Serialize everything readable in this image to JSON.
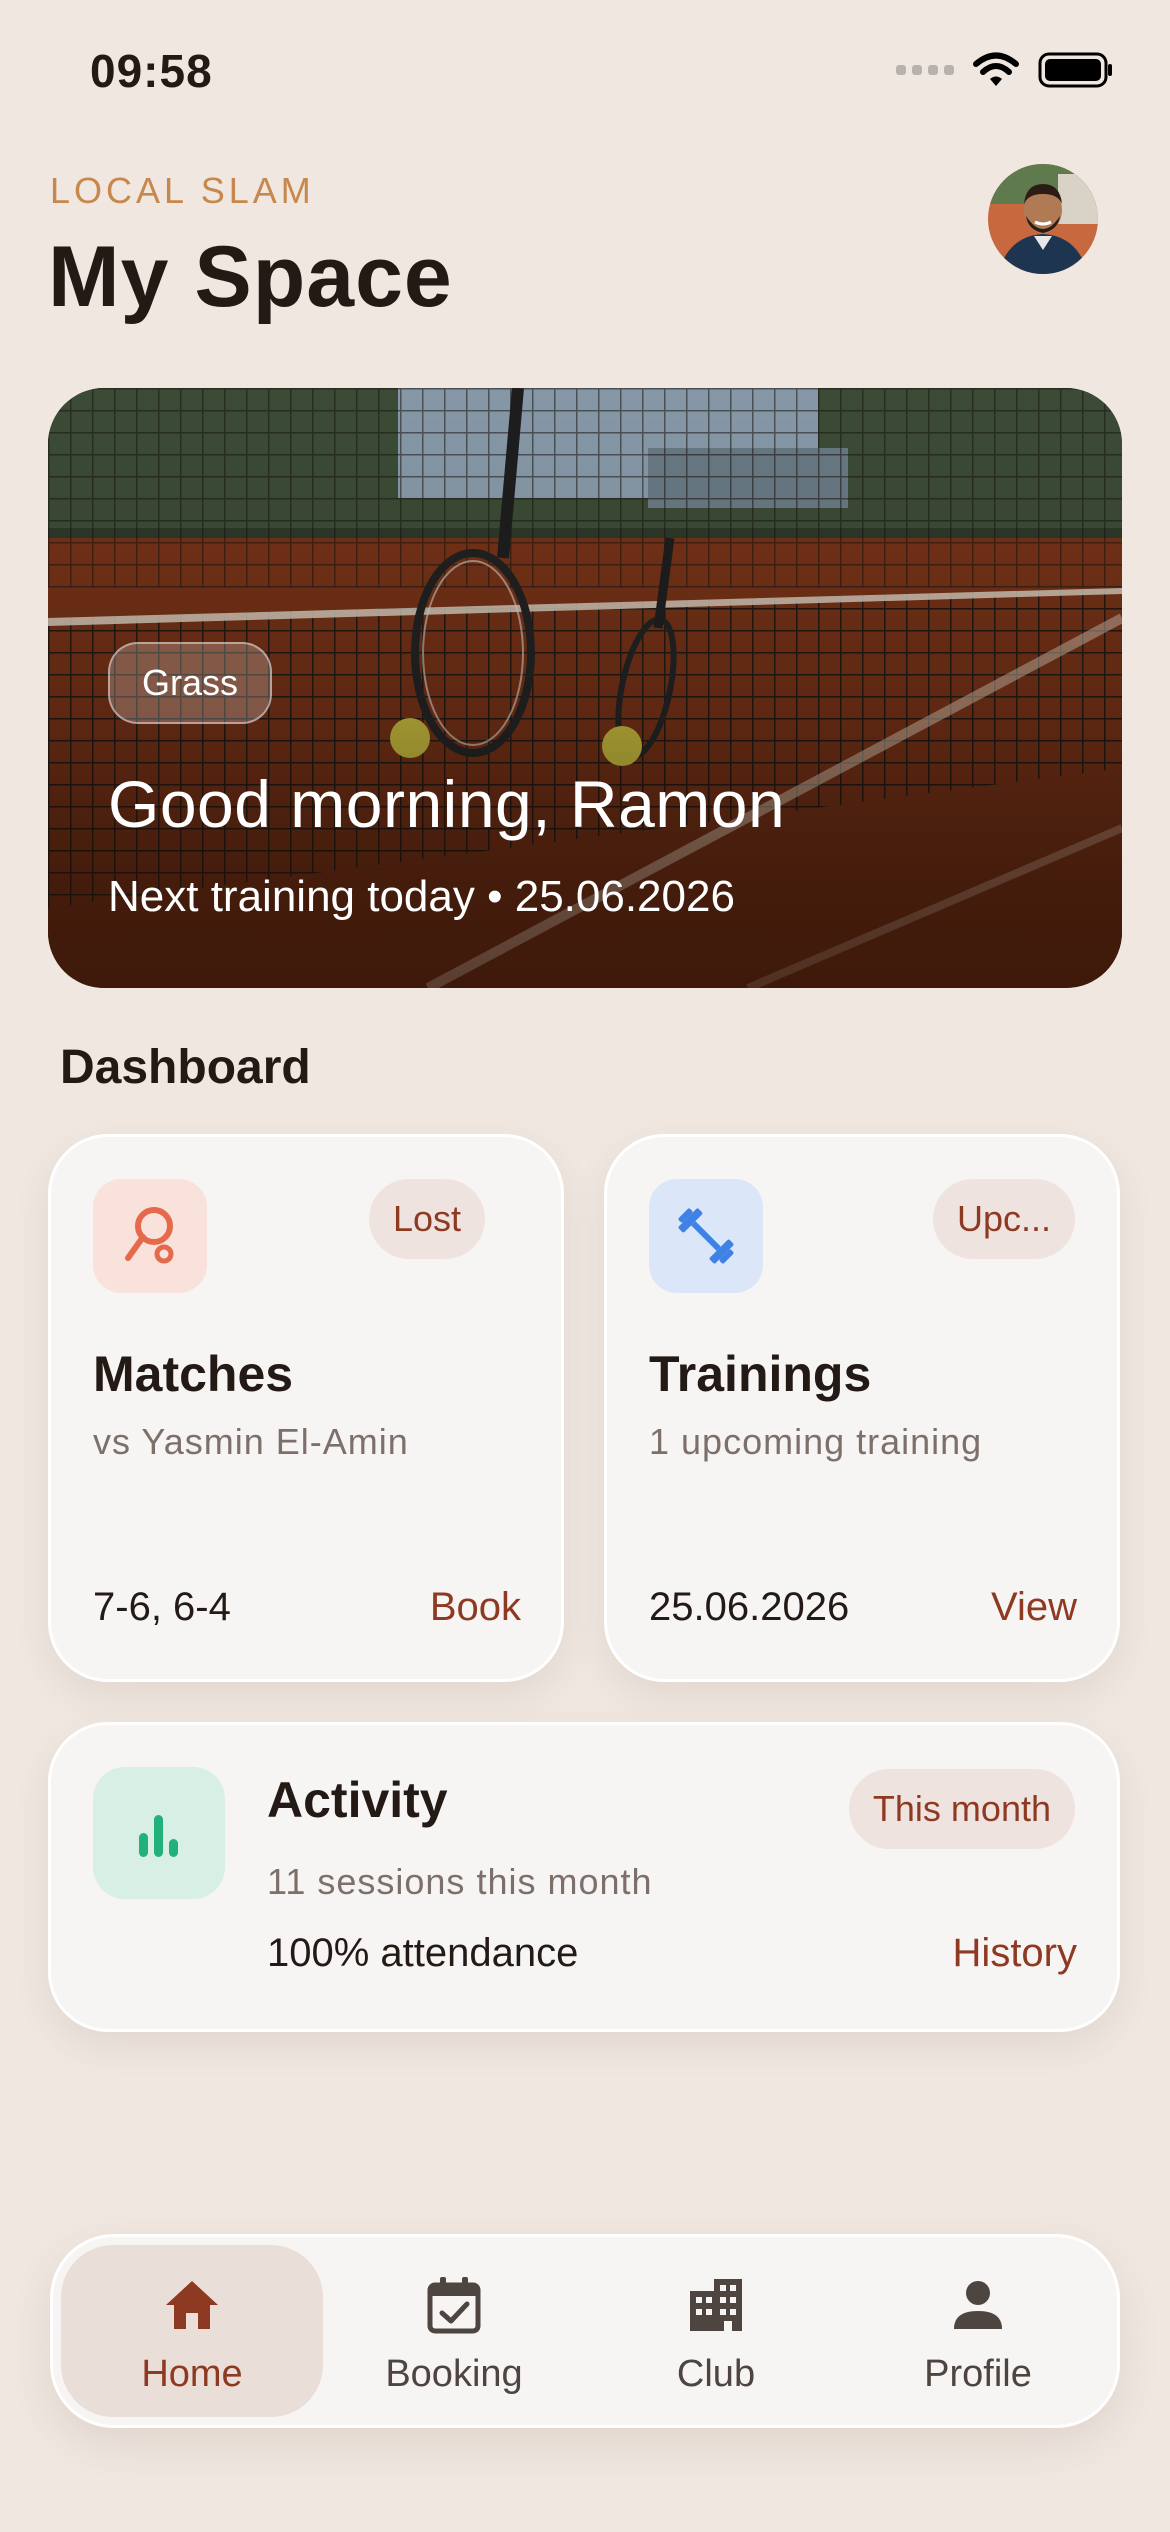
{
  "status_bar": {
    "time": "09:58"
  },
  "header": {
    "brand": "LOCAL SLAM",
    "title": "My Space"
  },
  "hero": {
    "surface_chip": "Grass",
    "greeting": "Good morning, Ramon",
    "subtitle": "Next training today • 25.06.2026"
  },
  "dashboard": {
    "section_title": "Dashboard",
    "matches": {
      "badge": "Lost",
      "title": "Matches",
      "subtitle": "vs Yasmin El-Amin",
      "score": "7-6, 6-4",
      "action": "Book",
      "icon": "tennis-racket-icon"
    },
    "trainings": {
      "badge": "Upc...",
      "title": "Trainings",
      "subtitle": "1 upcoming training",
      "date": "25.06.2026",
      "action": "View",
      "icon": "dumbbell-icon"
    },
    "activity": {
      "badge": "This month",
      "title": "Activity",
      "subtitle": "11 sessions this month",
      "attendance": "100% attendance",
      "action": "History",
      "icon": "bar-chart-icon"
    }
  },
  "bottom_nav": {
    "items": [
      {
        "label": "Home",
        "icon": "home-icon",
        "active": true
      },
      {
        "label": "Booking",
        "icon": "calendar-check-icon",
        "active": false
      },
      {
        "label": "Club",
        "icon": "building-icon",
        "active": false
      },
      {
        "label": "Profile",
        "icon": "person-icon",
        "active": false
      }
    ]
  },
  "colors": {
    "background": "#efe7e0",
    "accent": "#8e3a23",
    "brand": "#c8874c",
    "card": "#f7f5f4",
    "matches_tile": "#f8e2db",
    "trainings_tile": "#dbe6f8",
    "activity_tile": "#d8efe6"
  }
}
